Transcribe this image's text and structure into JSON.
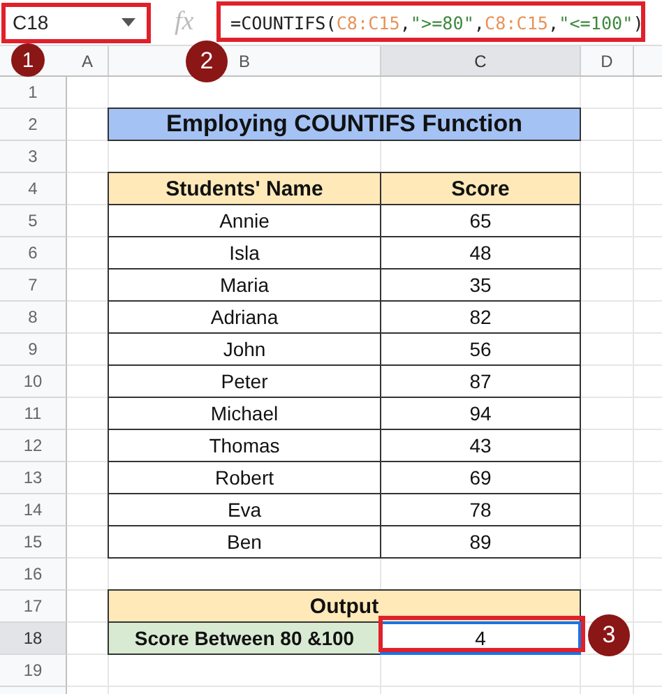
{
  "name_box": "C18",
  "fx": "fx",
  "formula": [
    {
      "kind": "plain",
      "text": "=COUNTIFS("
    },
    {
      "kind": "ref",
      "text": "C8:C15"
    },
    {
      "kind": "plain",
      "text": ","
    },
    {
      "kind": "string",
      "text": "\">=80\""
    },
    {
      "kind": "plain",
      "text": ","
    },
    {
      "kind": "ref",
      "text": "C8:C15"
    },
    {
      "kind": "plain",
      "text": ","
    },
    {
      "kind": "string",
      "text": "\"<=100\""
    },
    {
      "kind": "plain",
      "text": ")"
    }
  ],
  "columns": [
    {
      "label": "A",
      "selected": false
    },
    {
      "label": "B",
      "selected": false
    },
    {
      "label": "C",
      "selected": true
    },
    {
      "label": "D",
      "selected": false
    }
  ],
  "rows": [
    {
      "number": "1",
      "selected": false,
      "kind": "blank"
    },
    {
      "number": "2",
      "selected": false,
      "kind": "title",
      "text": "Employing COUNTIFS Function"
    },
    {
      "number": "3",
      "selected": false,
      "kind": "blank"
    },
    {
      "number": "4",
      "selected": false,
      "kind": "header",
      "cells": [
        "Students' Name",
        "Score"
      ]
    },
    {
      "number": "5",
      "selected": false,
      "kind": "data",
      "cells": [
        "Annie",
        "65"
      ]
    },
    {
      "number": "6",
      "selected": false,
      "kind": "data",
      "cells": [
        "Isla",
        "48"
      ]
    },
    {
      "number": "7",
      "selected": false,
      "kind": "data",
      "cells": [
        "Maria",
        "35"
      ]
    },
    {
      "number": "8",
      "selected": false,
      "kind": "data",
      "cells": [
        "Adriana",
        "82"
      ]
    },
    {
      "number": "9",
      "selected": false,
      "kind": "data",
      "cells": [
        "John",
        "56"
      ]
    },
    {
      "number": "10",
      "selected": false,
      "kind": "data",
      "cells": [
        "Peter",
        "87"
      ]
    },
    {
      "number": "11",
      "selected": false,
      "kind": "data",
      "cells": [
        "Michael",
        "94"
      ]
    },
    {
      "number": "12",
      "selected": false,
      "kind": "data",
      "cells": [
        "Thomas",
        "43"
      ]
    },
    {
      "number": "13",
      "selected": false,
      "kind": "data",
      "cells": [
        "Robert",
        "69"
      ]
    },
    {
      "number": "14",
      "selected": false,
      "kind": "data",
      "cells": [
        "Eva",
        "78"
      ]
    },
    {
      "number": "15",
      "selected": false,
      "kind": "data",
      "cells": [
        "Ben",
        "89"
      ]
    },
    {
      "number": "16",
      "selected": false,
      "kind": "blank"
    },
    {
      "number": "17",
      "selected": false,
      "kind": "output_header",
      "text": "Output"
    },
    {
      "number": "18",
      "selected": true,
      "kind": "output",
      "cells": [
        "Score Between 80 &100",
        "4"
      ]
    },
    {
      "number": "19",
      "selected": false,
      "kind": "blank"
    }
  ],
  "callouts": [
    "1",
    "2",
    "3"
  ]
}
